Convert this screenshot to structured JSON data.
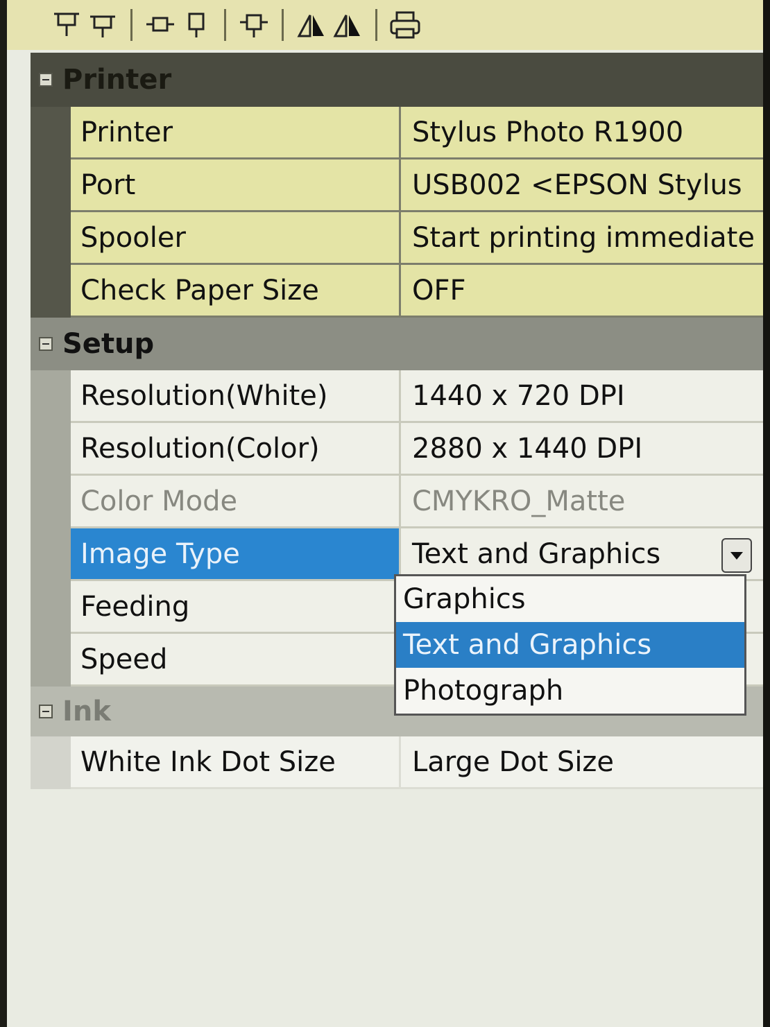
{
  "toolbar": {
    "buttons": [
      {
        "icon": "align-top-icon"
      },
      {
        "icon": "align-bottom-icon"
      },
      {
        "icon": "align-center-icon"
      },
      {
        "icon": "align-down-icon"
      },
      {
        "icon": "distribute-icon"
      },
      {
        "icon": "flip-left-icon"
      },
      {
        "icon": "flip-right-icon"
      },
      {
        "icon": "print-icon"
      }
    ]
  },
  "grid": {
    "printer": {
      "label": "Printer",
      "rows": [
        {
          "name": "Printer",
          "value": "Stylus Photo R1900"
        },
        {
          "name": "Port",
          "value": "USB002  <EPSON Stylus"
        },
        {
          "name": "Spooler",
          "value": "Start printing immediate"
        },
        {
          "name": "Check Paper Size",
          "value": "OFF"
        }
      ]
    },
    "setup": {
      "label": "Setup",
      "rows": [
        {
          "name": "Resolution(White)",
          "value": "1440 x 720 DPI"
        },
        {
          "name": "Resolution(Color)",
          "value": "2880 x 1440 DPI"
        },
        {
          "name": "Color Mode",
          "value": "CMYKRO_Matte"
        },
        {
          "name": "Image Type",
          "value": "Text and Graphics"
        },
        {
          "name": "Feeding",
          "value": ""
        },
        {
          "name": "Speed",
          "value": ""
        }
      ]
    },
    "ink": {
      "label": "Ink",
      "rows": [
        {
          "name": "White Ink Dot Size",
          "value": "Large Dot Size"
        }
      ]
    }
  },
  "dropdown": {
    "options": [
      "Graphics",
      "Text and Graphics",
      "Photograph"
    ],
    "selected": "Text and Graphics"
  },
  "colors": {
    "selection": "#2a86d0",
    "printer_row_bg": "#e4e4a6",
    "category_dark": "#4a4b40"
  }
}
